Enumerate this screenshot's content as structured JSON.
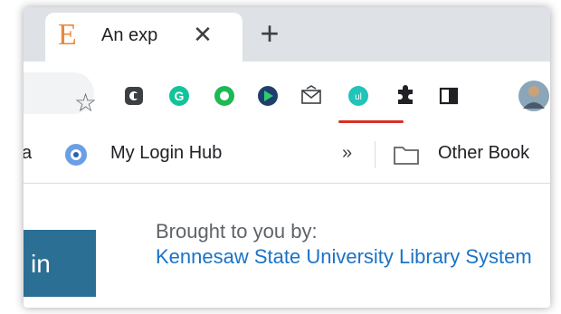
{
  "tab": {
    "favicon": "E",
    "title": "An exp",
    "close": "✕",
    "new_tab": "+"
  },
  "toolbar": {
    "bookmark_star": "☆",
    "extensions": [
      "chrome-extension-icon",
      "grammarly-icon",
      "green-circle-extension-icon",
      "blue-green-extension-icon",
      "mail-extension-icon",
      "teal-extension-icon",
      "puzzle-icon",
      "side-panel-icon",
      "profile-avatar"
    ],
    "highlight_color": "#d93025"
  },
  "bookmarks": {
    "cut_label": "a",
    "items": [
      {
        "label": "My Login Hub"
      }
    ],
    "overflow": "»",
    "other": "Other Book"
  },
  "content": {
    "badge": "in",
    "brought_by": "Brought to you by:",
    "library": "Kennesaw State University Library System"
  },
  "colors": {
    "tab_strip": "#dee1e6",
    "linkedin_blue": "#2b6f94",
    "link_blue": "#1a73c8",
    "tab_favicon": "#e8883c"
  }
}
